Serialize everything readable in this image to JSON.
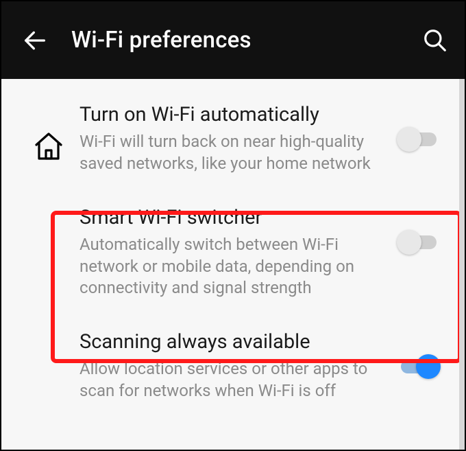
{
  "appbar": {
    "title": "Wi-Fi preferences"
  },
  "settings": [
    {
      "icon": "home",
      "title": "Turn on Wi-Fi automatically",
      "description": "Wi-Fi will turn back on near high-quality saved networks, like your home network",
      "enabled": false
    },
    {
      "icon": "",
      "title": "Smart Wi-Fi switcher",
      "description": "Automatically switch between Wi-Fi network or mobile data, depending on connectivity and signal strength",
      "enabled": false,
      "highlighted": true
    },
    {
      "icon": "",
      "title": "Scanning always available",
      "description": "Allow location services or other apps to scan for networks when Wi-Fi is off",
      "enabled": true
    }
  ]
}
